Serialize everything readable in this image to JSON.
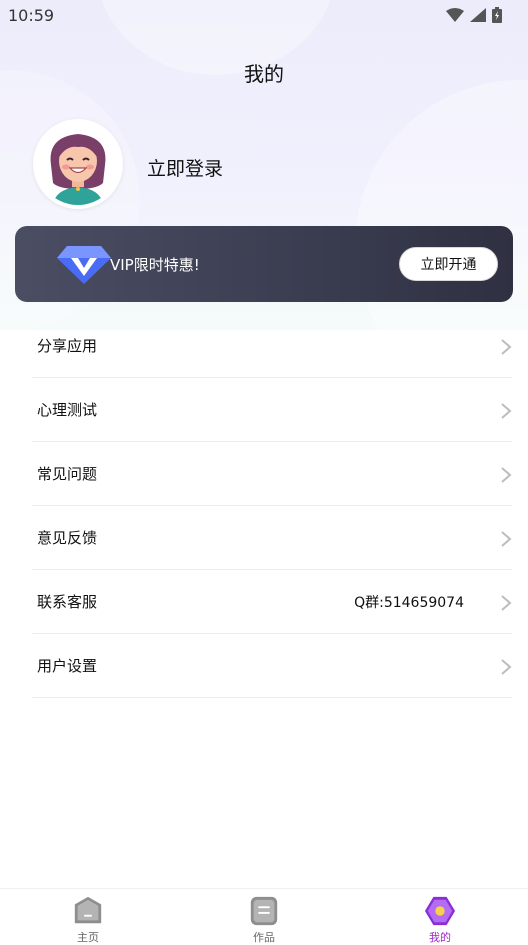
{
  "status_bar": {
    "time": "10:59",
    "icons": [
      "wifi-icon",
      "signal-icon",
      "battery-icon"
    ]
  },
  "header": {
    "title": "我的"
  },
  "profile": {
    "avatar_icon": "user-avatar",
    "login_text": "立即登录"
  },
  "vip": {
    "icon": "diamond-icon",
    "text": "VIP限时特惠!",
    "button_label": "立即开通"
  },
  "menu": {
    "items": [
      {
        "label": "分享应用",
        "value": ""
      },
      {
        "label": "心理测试",
        "value": ""
      },
      {
        "label": "常见问题",
        "value": ""
      },
      {
        "label": "意见反馈",
        "value": ""
      },
      {
        "label": "联系客服",
        "value": "Q群:514659074"
      },
      {
        "label": "用户设置",
        "value": ""
      }
    ]
  },
  "tabbar": {
    "tabs": [
      {
        "label": "主页",
        "icon": "home-icon",
        "active": false
      },
      {
        "label": "作品",
        "icon": "works-icon",
        "active": false
      },
      {
        "label": "我的",
        "icon": "profile-icon",
        "active": true
      }
    ]
  },
  "colors": {
    "accent": "#9e27c9",
    "vip_card": "#3d3f53",
    "header_bg": "#ececfb"
  }
}
